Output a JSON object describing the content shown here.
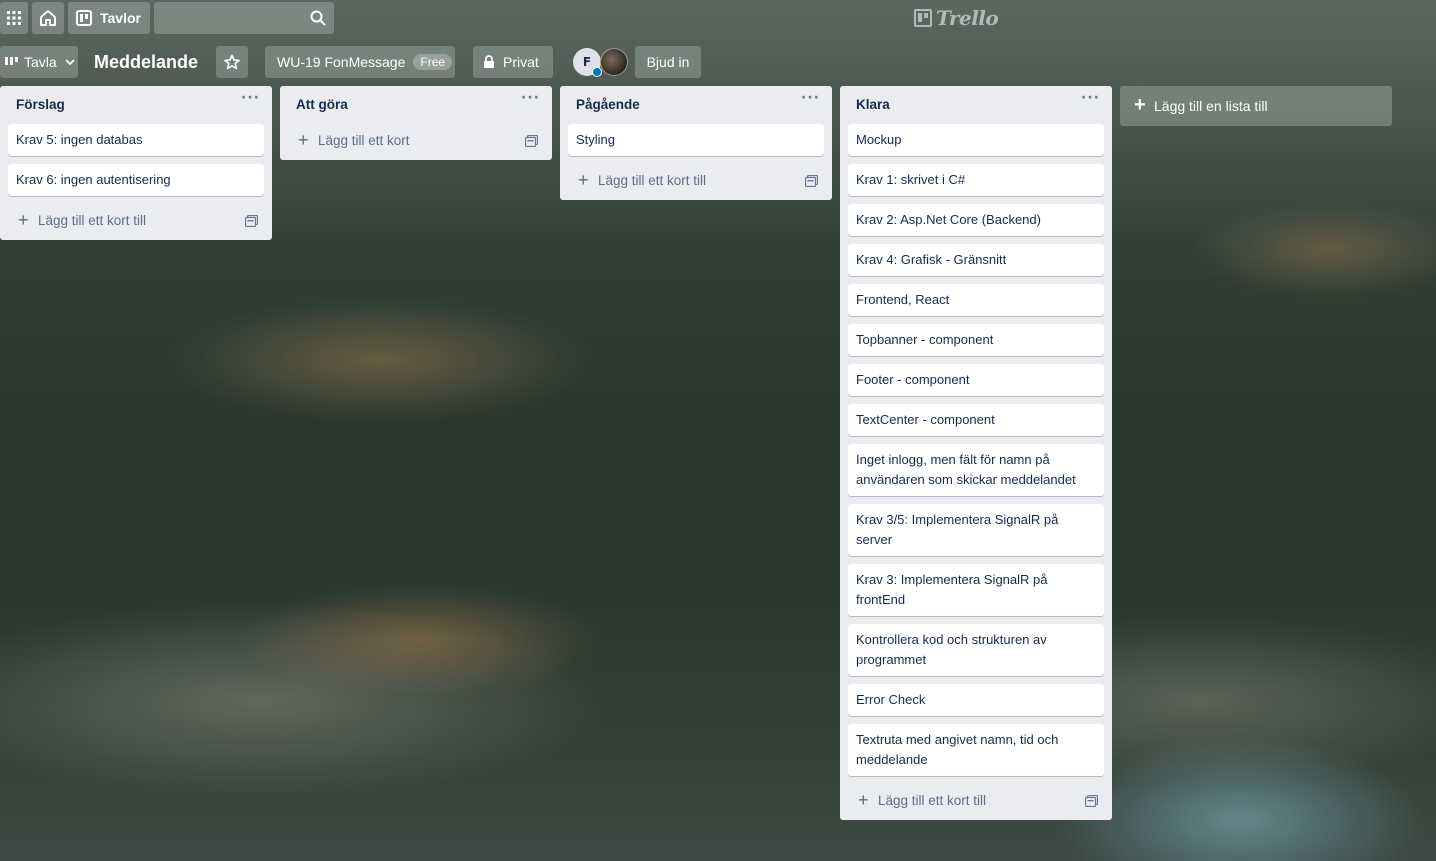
{
  "topbar": {
    "apps_icon": "grid-icon",
    "home_icon": "home-icon",
    "boards_label": "Tavlor",
    "search_placeholder": "",
    "logo_text": "Trello"
  },
  "board": {
    "view_label": "Tavla",
    "title": "Meddelande",
    "team_label": "WU-19 FonMessage",
    "team_badge": "Free",
    "visibility_label": "Privat",
    "member_initial": "F",
    "invite_label": "Bjud in"
  },
  "lists": [
    {
      "title": "Förslag",
      "cards": [
        "Krav 5: ingen databas",
        "Krav 6: ingen autentisering"
      ],
      "add_card_label": "Lägg till ett kort till"
    },
    {
      "title": "Att göra",
      "cards": [],
      "add_card_label": "Lägg till ett kort"
    },
    {
      "title": "Pågående",
      "cards": [
        "Styling"
      ],
      "add_card_label": "Lägg till ett kort till"
    },
    {
      "title": "Klara",
      "cards": [
        "Mockup",
        "Krav 1: skrivet i C#",
        "Krav 2: Asp.Net Core (Backend)",
        "Krav 4: Grafisk - Gränsnitt",
        "Frontend, React",
        "Topbanner - component",
        "Footer - component",
        "TextCenter - component",
        "Inget inlogg, men fält för namn på användaren som skickar meddelandet",
        "Krav 3/5: Implementera SignalR på server",
        "Krav 3: Implementera SignalR på frontEnd",
        "Kontrollera kod och strukturen av programmet",
        "Error Check",
        "Textruta med angivet namn, tid och meddelande"
      ],
      "add_card_label": "Lägg till ett kort till"
    }
  ],
  "add_list_label": "Lägg till en lista till",
  "list_menu_text": "···"
}
